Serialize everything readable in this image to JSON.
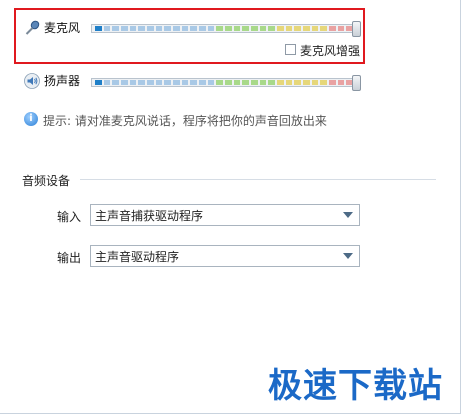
{
  "microphone": {
    "label": "麦克风",
    "icon": "microphone-icon",
    "level": 0.04,
    "volume": 1.0,
    "boost_label": "麦克风增强",
    "boost_checked": false
  },
  "speaker": {
    "label": "扬声器",
    "icon": "speaker-icon",
    "level": 0.04,
    "volume": 1.0
  },
  "tip": {
    "text": "提示: 请对准麦克风说话，程序将把你的声音回放出来",
    "icon": "info-icon"
  },
  "audio_device": {
    "section_title": "音频设备",
    "input_label": "输入",
    "input_value": "主声音捕获驱动程序",
    "output_label": "输出",
    "output_value": "主声音驱动程序"
  },
  "watermark": "极速下载站",
  "colors": {
    "highlight": "#e0191f",
    "accent": "#1b69c7",
    "meter_green": "#a8d98a",
    "meter_yellow": "#e6d77a",
    "meter_red": "#e9a2a2",
    "meter_blue": "#a9c9e6"
  }
}
